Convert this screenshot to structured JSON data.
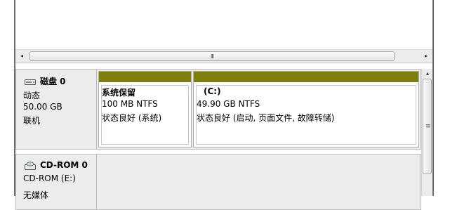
{
  "scrollbar": {
    "left_arrow": "◂",
    "right_arrow": "▸",
    "grip": "III",
    "up_arrow": "▴",
    "vgrip": "≡"
  },
  "disks": [
    {
      "name": "磁盘 0",
      "icon": "hard-disk-icon",
      "type": "动态",
      "size": "50.00 GB",
      "status": "联机",
      "partitions": [
        {
          "label": "系统保留",
          "info": "100 MB NTFS",
          "health": "状态良好 (系统)"
        },
        {
          "label": "(C:)",
          "info": "49.90 GB NTFS",
          "health": "状态良好 (启动, 页面文件, 故障转储)"
        }
      ]
    },
    {
      "name": "CD-ROM 0",
      "icon": "cd-rom-icon",
      "type": "CD-ROM (E:)",
      "status_partial": "无媒体"
    }
  ],
  "colors": {
    "partition_bar": "#7f7f0e",
    "panel_bg": "#ececec"
  }
}
